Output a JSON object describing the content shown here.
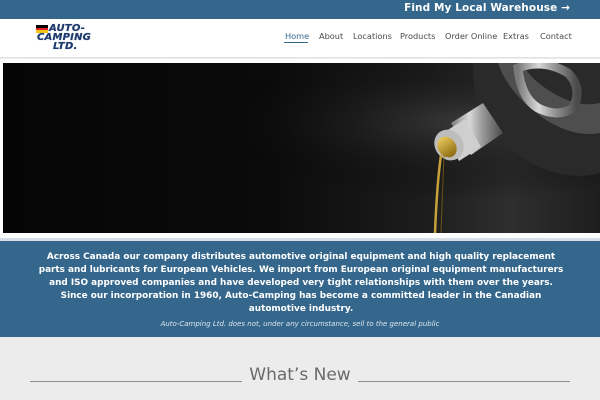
{
  "topbar": {
    "warehouse_link": "Find My Local Warehouse →"
  },
  "logo": {
    "line1": "AUTO-",
    "line2": "CAMPING",
    "line3": "LTD.",
    "flag_colors": [
      "#000000",
      "#dd1f26",
      "#f5c518"
    ]
  },
  "nav": {
    "items": [
      {
        "label": "Home",
        "active": true
      },
      {
        "label": "About"
      },
      {
        "label": "Locations"
      },
      {
        "label": "Products"
      },
      {
        "label": "Order Online"
      },
      {
        "label": "Extras"
      },
      {
        "label": "Contact"
      }
    ]
  },
  "info": {
    "text": "Across Canada our company distributes automotive original equipment and high quality replacement parts and lubricants for European Vehicles. We import from European original equipment manufacturers and ISO approved companies and have developed very tight relationships with them over the years. Since our incorporation in 1960, Auto-Camping has become a committed leader in the Canadian automotive industry.",
    "note": "Auto-Camping Ltd. does not, under any circumstance, sell to the general public"
  },
  "whats_new": {
    "title": "What’s New"
  },
  "colors": {
    "brand_blue": "#35678c",
    "logo_navy": "#1f3b6e",
    "oil_gold": "#c9a13a"
  }
}
